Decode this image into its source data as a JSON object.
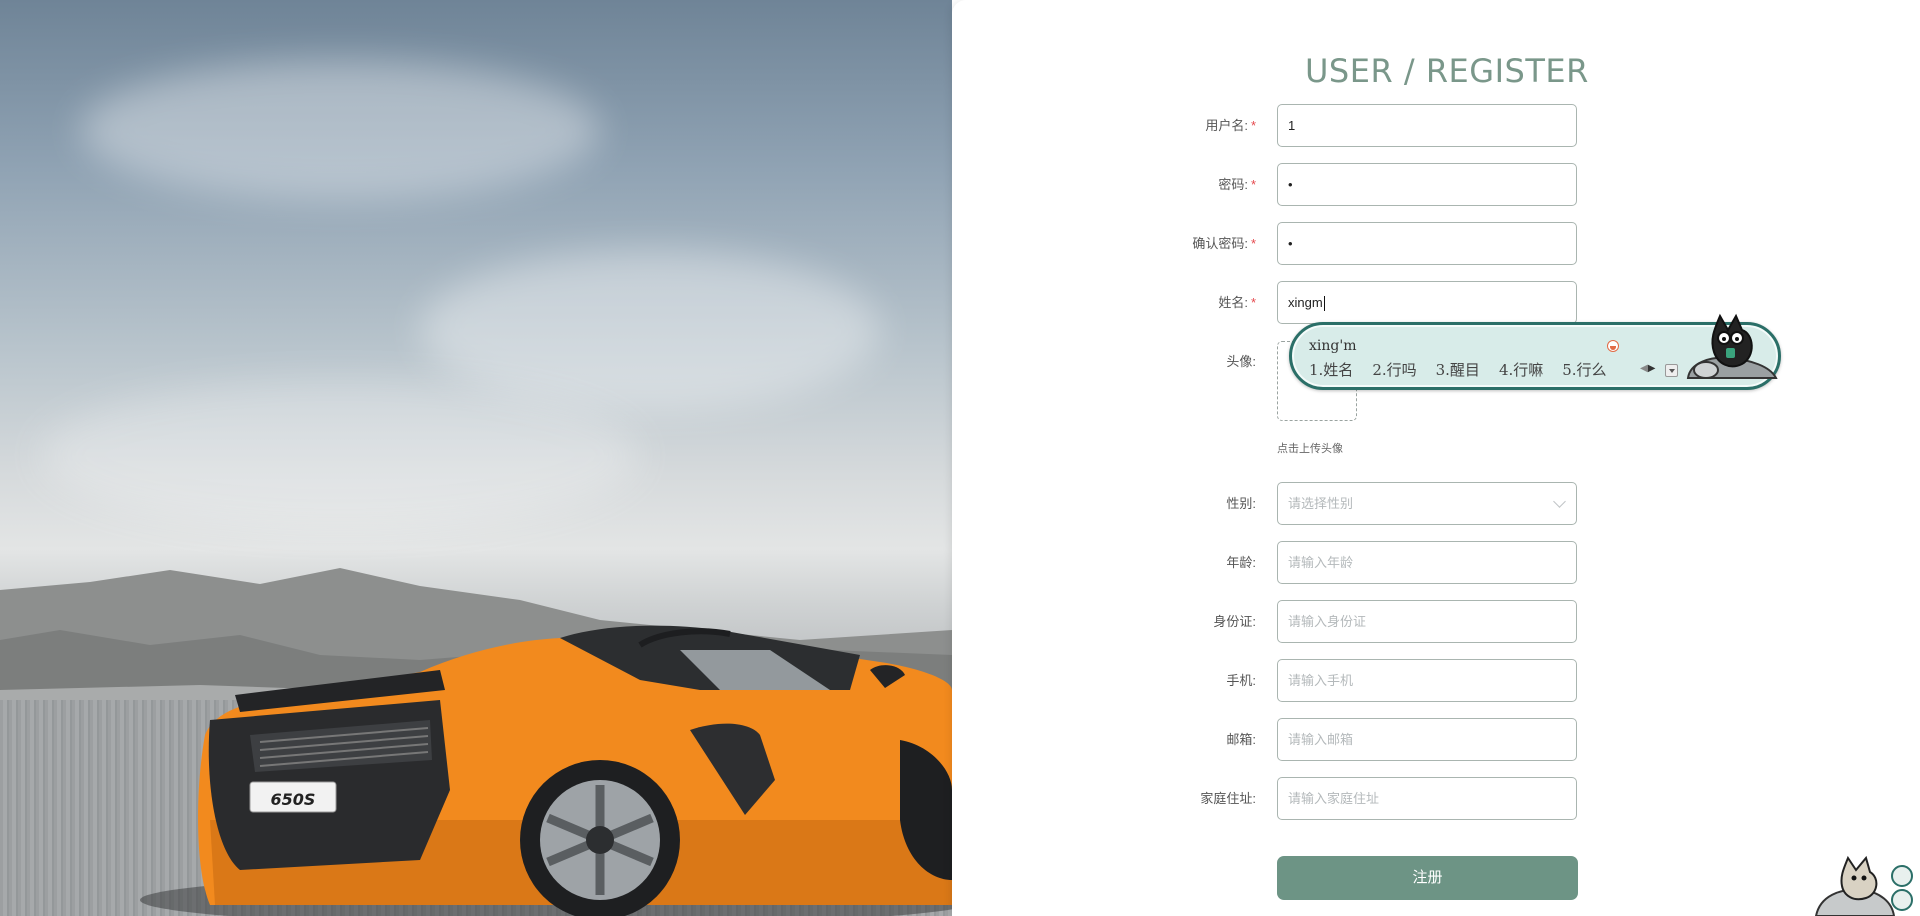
{
  "form": {
    "title": "USER / REGISTER",
    "required_mark": "*",
    "username": {
      "label": "用户名:",
      "value": "1"
    },
    "password": {
      "label": "密码:",
      "value": "•"
    },
    "confirm_password": {
      "label": "确认密码:",
      "value": "•"
    },
    "name": {
      "label": "姓名:",
      "value": "xingm"
    },
    "avatar": {
      "label": "头像:",
      "tip": "点击上传头像"
    },
    "gender": {
      "label": "性别:",
      "placeholder": "请选择性别"
    },
    "age": {
      "label": "年龄:",
      "placeholder": "请输入年龄"
    },
    "id_card": {
      "label": "身份证:",
      "placeholder": "请输入身份证"
    },
    "phone": {
      "label": "手机:",
      "placeholder": "请输入手机"
    },
    "email": {
      "label": "邮箱:",
      "placeholder": "请输入邮箱"
    },
    "address": {
      "label": "家庭住址:",
      "placeholder": "请输入家庭住址"
    },
    "submit_label": "注册"
  },
  "ime": {
    "pinyin": "xing'm",
    "candidates": [
      "1.姓名",
      "2.行吗",
      "3.醒目",
      "4.行嘛",
      "5.行么"
    ]
  },
  "scene": {
    "car_plate": "650S",
    "car_color": "#f28a1e"
  },
  "colors": {
    "accent": "#6d9485",
    "title": "#7a978a",
    "required": "#e5484d",
    "ime_border": "#2b6f68"
  }
}
